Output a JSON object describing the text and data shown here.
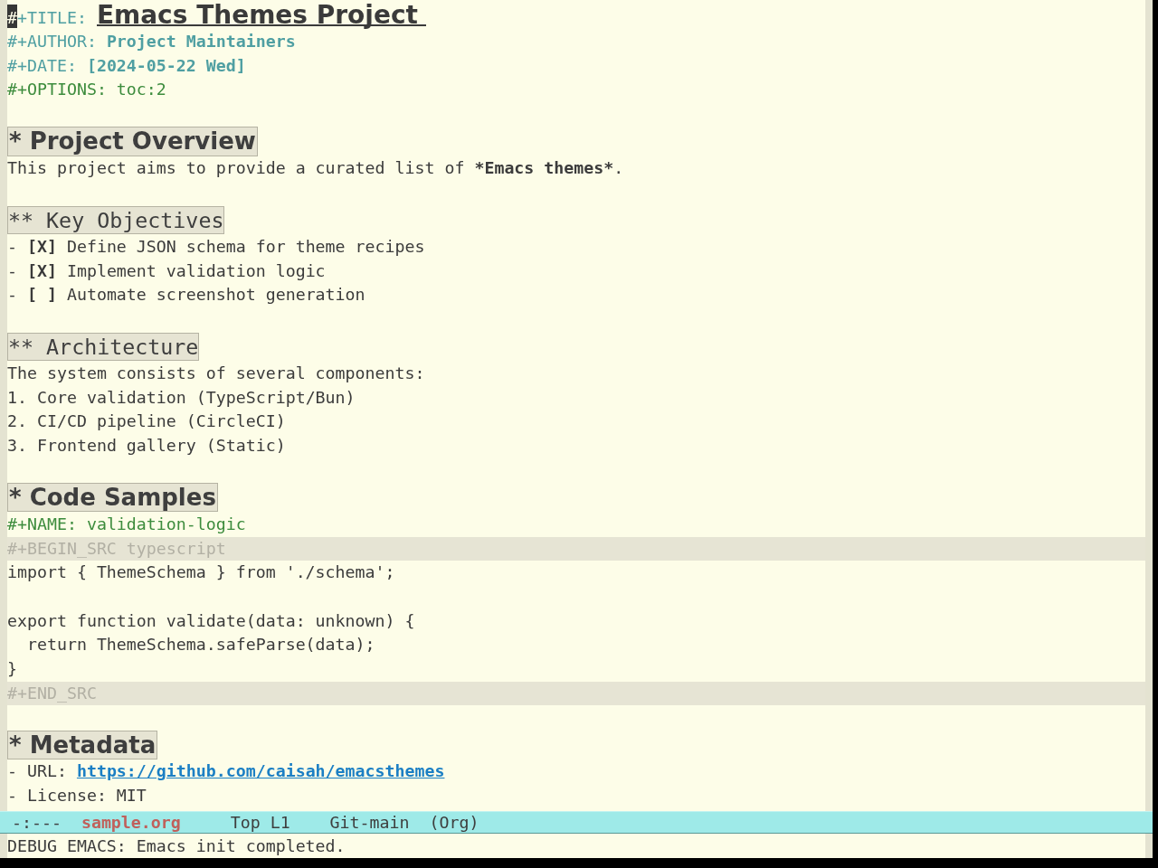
{
  "buffer": {
    "lines": [
      {
        "kind": "title",
        "key": "#+TITLE:",
        "value": "Emacs Themes Project",
        "cursor": true
      },
      {
        "kind": "meta",
        "key": "#+AUTHOR:",
        "value": "Project Maintainers",
        "cursor": false
      },
      {
        "kind": "meta",
        "key": "#+DATE:",
        "value": "[2024-05-22 Wed]",
        "cursor": false
      },
      {
        "kind": "setting",
        "key": "#+OPTIONS:",
        "value": "toc:2",
        "cursor": false
      },
      {
        "kind": "blank"
      },
      {
        "kind": "heading",
        "text": "* Project Overview"
      },
      {
        "kind": "paragraph",
        "segments": [
          {
            "text": "This project aims to provide a curated list of ",
            "bold": false
          },
          {
            "text": "*Emacs themes*",
            "bold": true
          },
          {
            "text": ".",
            "bold": false
          }
        ]
      },
      {
        "kind": "blank"
      },
      {
        "kind": "subheading",
        "text": "** Key Objectives"
      },
      {
        "kind": "item",
        "bullet": "-",
        "checkbox": "[X]",
        "text": "Define JSON schema for theme recipes"
      },
      {
        "kind": "item",
        "bullet": "-",
        "checkbox": "[X]",
        "text": "Implement validation logic"
      },
      {
        "kind": "item",
        "bullet": "-",
        "checkbox": "[ ]",
        "text": "Automate screenshot generation"
      },
      {
        "kind": "blank"
      },
      {
        "kind": "subheading",
        "text": "** Architecture"
      },
      {
        "kind": "paragraph",
        "segments": [
          {
            "text": "The system consists of several components:",
            "bold": false
          }
        ]
      },
      {
        "kind": "item",
        "bullet": "1.",
        "text": "Core validation (TypeScript/Bun)"
      },
      {
        "kind": "item",
        "bullet": "2.",
        "text": "CI/CD pipeline (CircleCI)"
      },
      {
        "kind": "item",
        "bullet": "3.",
        "text": "Frontend gallery (Static)"
      },
      {
        "kind": "blank"
      },
      {
        "kind": "heading",
        "text": "* Code Samples"
      },
      {
        "kind": "setting",
        "key": "#+NAME:",
        "value": "validation-logic",
        "cursor": false
      },
      {
        "kind": "delimiter",
        "text": "#+BEGIN_SRC typescript"
      },
      {
        "kind": "code",
        "text": "import { ThemeSchema } from './schema';"
      },
      {
        "kind": "blank"
      },
      {
        "kind": "code",
        "text": "export function validate(data: unknown) {"
      },
      {
        "kind": "code",
        "text": "  return ThemeSchema.safeParse(data);"
      },
      {
        "kind": "code",
        "text": "}"
      },
      {
        "kind": "delimiter",
        "text": "#+END_SRC"
      },
      {
        "kind": "blank"
      },
      {
        "kind": "heading",
        "text": "* Metadata"
      },
      {
        "kind": "item",
        "bullet": "-",
        "text": "URL:",
        "link": "https://github.com/caisah/emacsthemes"
      },
      {
        "kind": "item",
        "bullet": "-",
        "text": "License: MIT"
      }
    ]
  },
  "mode_line": {
    "status": "-:---",
    "buffer_name": "sample.org",
    "position": "Top L1",
    "branch": "Git-main",
    "mode": "(Org)"
  },
  "echo_area": {
    "message": "DEBUG EMACS: Emacs init completed."
  }
}
